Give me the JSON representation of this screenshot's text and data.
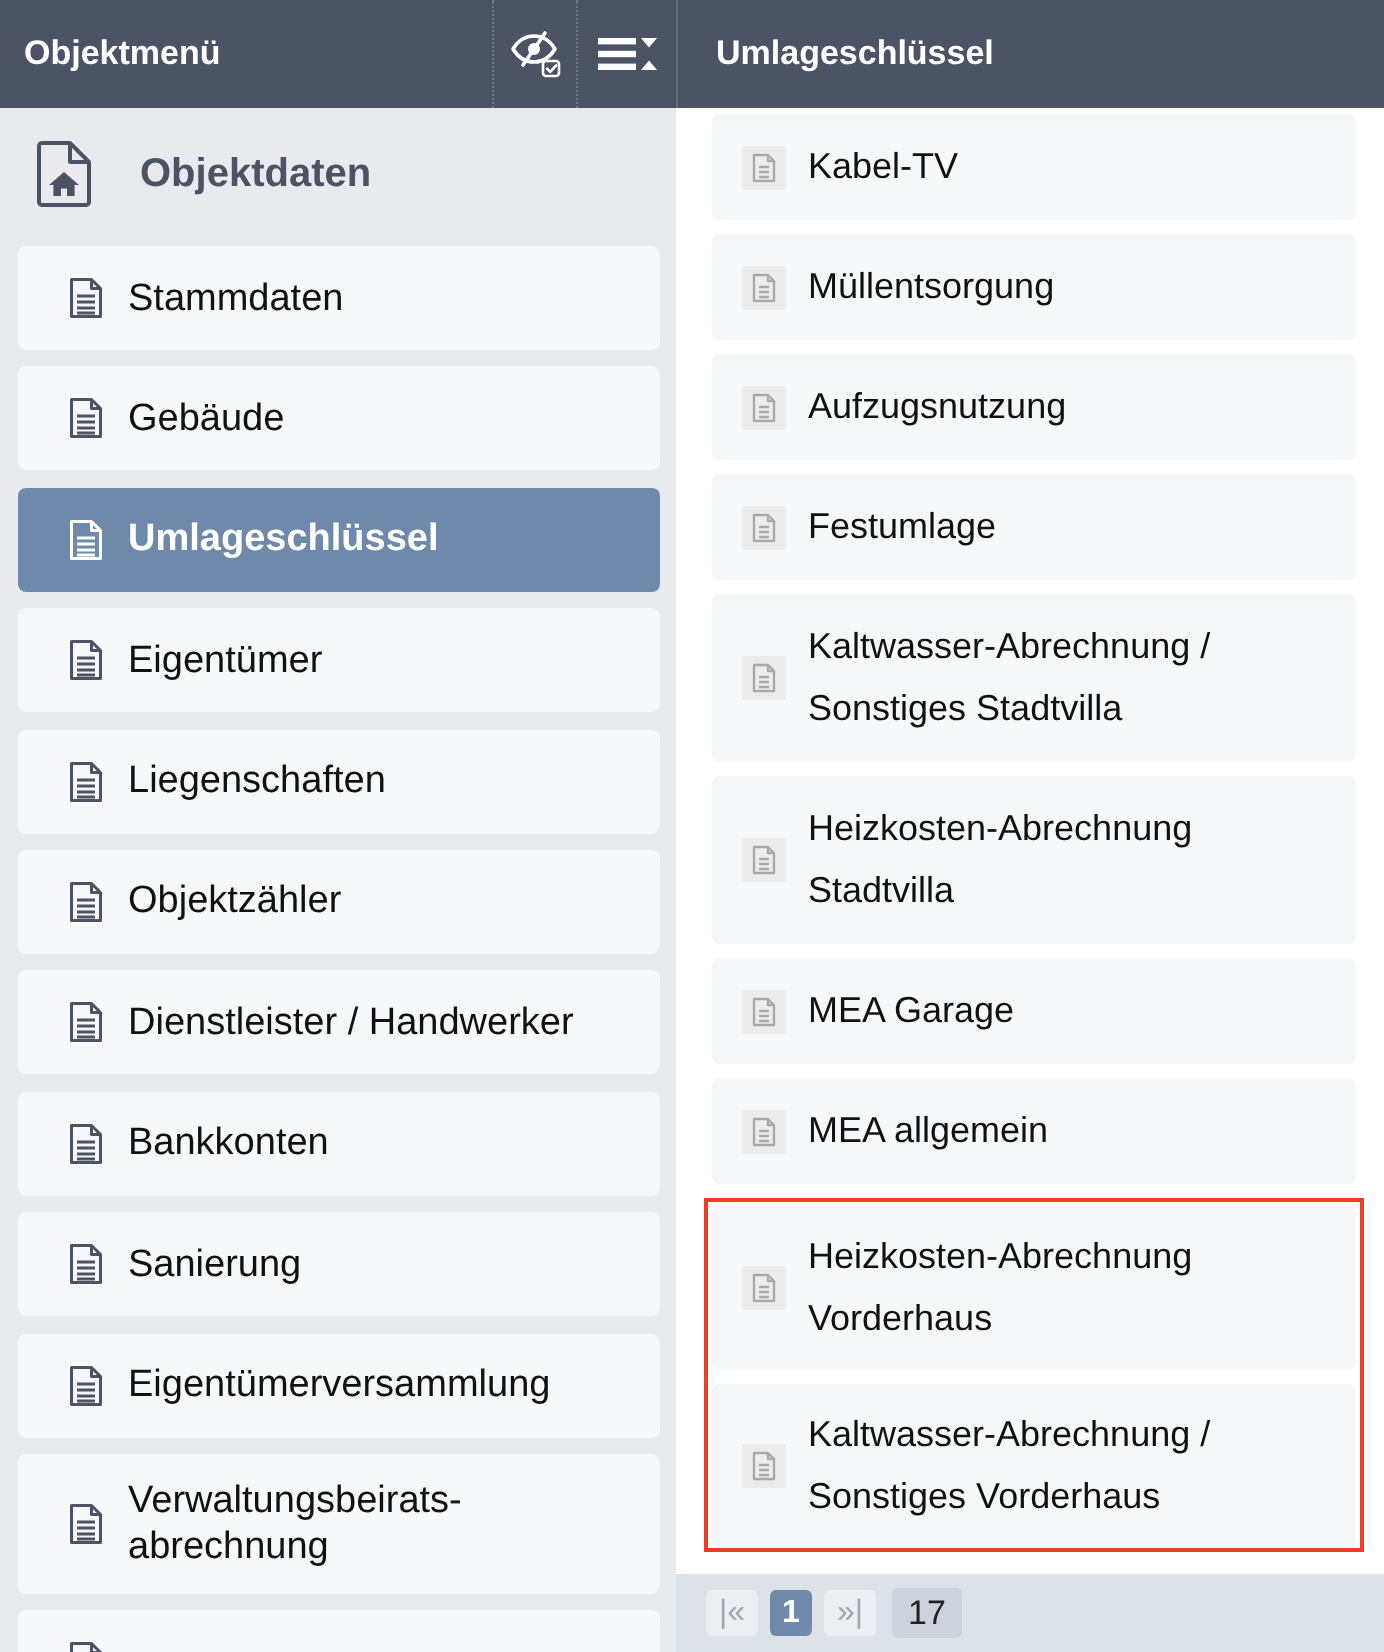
{
  "object_menu": {
    "title": "Objektmenü",
    "tools": [
      {
        "kind": "visibility"
      },
      {
        "kind": "collapse"
      }
    ],
    "section": {
      "title": "Objektdaten"
    },
    "items": [
      {
        "label": "Stammdaten",
        "selected": false
      },
      {
        "label": "Gebäude",
        "selected": false
      },
      {
        "label": "Umlageschlüssel",
        "selected": true
      },
      {
        "label": "Eigentümer",
        "selected": false
      },
      {
        "label": "Liegenschaften",
        "selected": false
      },
      {
        "label": "Objektzähler",
        "selected": false
      },
      {
        "label": "Dienstleister / Handwerker",
        "selected": false
      },
      {
        "label": "Bankkonten",
        "selected": false
      },
      {
        "label": "Sanierung",
        "selected": false
      },
      {
        "label": "Eigentümerversammlung",
        "selected": false
      },
      {
        "label": "Verwaltungsbeirats-abrechnung",
        "selected": false
      }
    ],
    "more_below": true
  },
  "key_list": {
    "title": "Umlageschlüssel",
    "items": [
      {
        "label": "Kabel-TV",
        "marked": false
      },
      {
        "label": "Müllentsorgung",
        "marked": false
      },
      {
        "label": "Aufzugsnutzung",
        "marked": false
      },
      {
        "label": "Festumlage",
        "marked": false
      },
      {
        "label": "Kaltwasser-Abrechnung / Sonstiges Stadtvilla",
        "marked": false
      },
      {
        "label": "Heizkosten-Abrechnung Stadtvilla",
        "marked": false
      },
      {
        "label": "MEA Garage",
        "marked": false
      },
      {
        "label": "MEA allgemein",
        "marked": false
      },
      {
        "label": "Heizkosten-Abrechnung Vorderhaus",
        "marked": true
      },
      {
        "label": "Kaltwasser-Abrechnung / Sonstiges Vorderhaus",
        "marked": true
      }
    ],
    "pager": {
      "first": {
        "label": "|«",
        "disabled": true
      },
      "pages": [
        {
          "label": "1",
          "selected": true
        }
      ],
      "last": {
        "label": "»|",
        "disabled": true
      },
      "total": "17"
    }
  }
}
